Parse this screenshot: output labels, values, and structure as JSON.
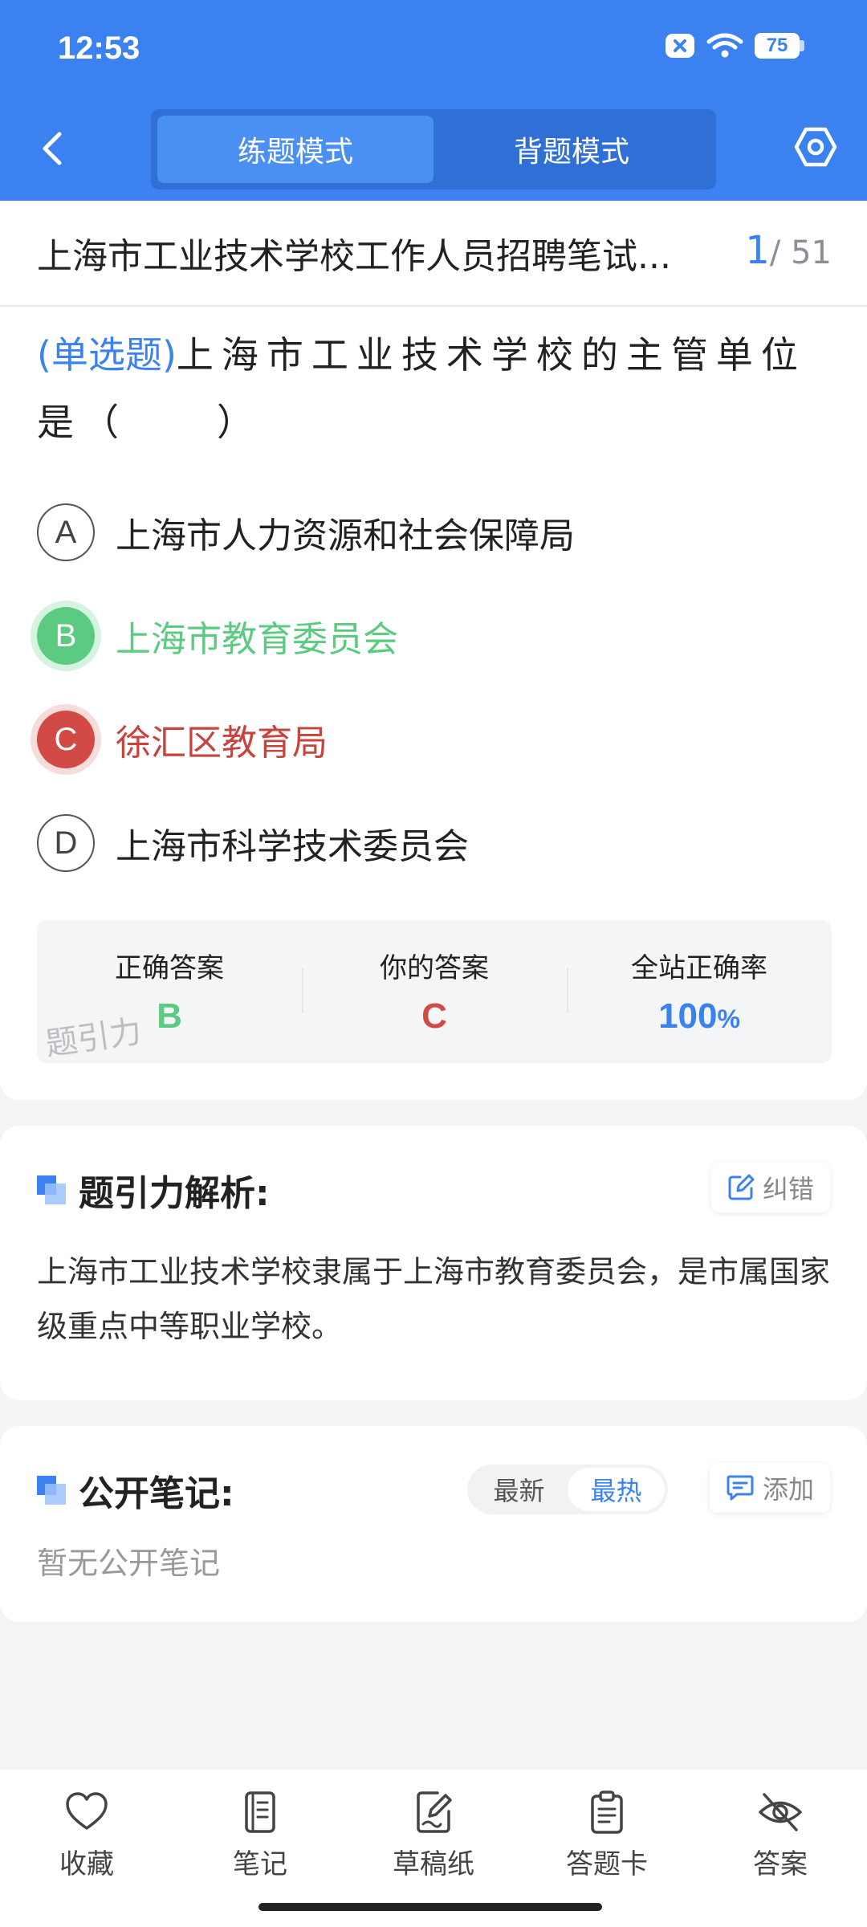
{
  "status_bar": {
    "time": "12:53",
    "battery": "75"
  },
  "header": {
    "tabs": [
      {
        "label": "练题模式",
        "active": true
      },
      {
        "label": "背题模式",
        "active": false
      }
    ]
  },
  "exam": {
    "title": "上海市工业技术学校工作人员招聘笔试...",
    "current": "1",
    "total": "/ 51"
  },
  "question": {
    "type": "(单选题)",
    "text": "上海市工业技术学校的主管单位是（　　）",
    "options": [
      {
        "letter": "A",
        "text": "上海市人力资源和社会保障局",
        "state": "normal"
      },
      {
        "letter": "B",
        "text": "上海市教育委员会",
        "state": "correct"
      },
      {
        "letter": "C",
        "text": "徐汇区教育局",
        "state": "wrong"
      },
      {
        "letter": "D",
        "text": "上海市科学技术委员会",
        "state": "normal"
      }
    ]
  },
  "stats": {
    "correct_label": "正确答案",
    "correct_value": "B",
    "yours_label": "你的答案",
    "yours_value": "C",
    "rate_label": "全站正确率",
    "rate_value": "100",
    "rate_unit": "%",
    "watermark": "题引力"
  },
  "analysis": {
    "title": "题引力解析:",
    "report_label": "纠错",
    "text": "上海市工业技术学校隶属于上海市教育委员会，是市属国家级重点中等职业学校。"
  },
  "notes": {
    "title": "公开笔记:",
    "sort_options": [
      {
        "label": "最新",
        "active": false
      },
      {
        "label": "最热",
        "active": true
      }
    ],
    "add_label": "添加",
    "empty_text": "暂无公开笔记"
  },
  "bottom_bar": [
    {
      "label": "收藏",
      "icon": "heart-icon"
    },
    {
      "label": "笔记",
      "icon": "notebook-icon"
    },
    {
      "label": "草稿纸",
      "icon": "draft-icon"
    },
    {
      "label": "答题卡",
      "icon": "clipboard-icon"
    },
    {
      "label": "答案",
      "icon": "eye-off-icon"
    }
  ],
  "colors": {
    "primary": "#3b82f0",
    "correct": "#5ccb82",
    "wrong": "#d24a45"
  }
}
